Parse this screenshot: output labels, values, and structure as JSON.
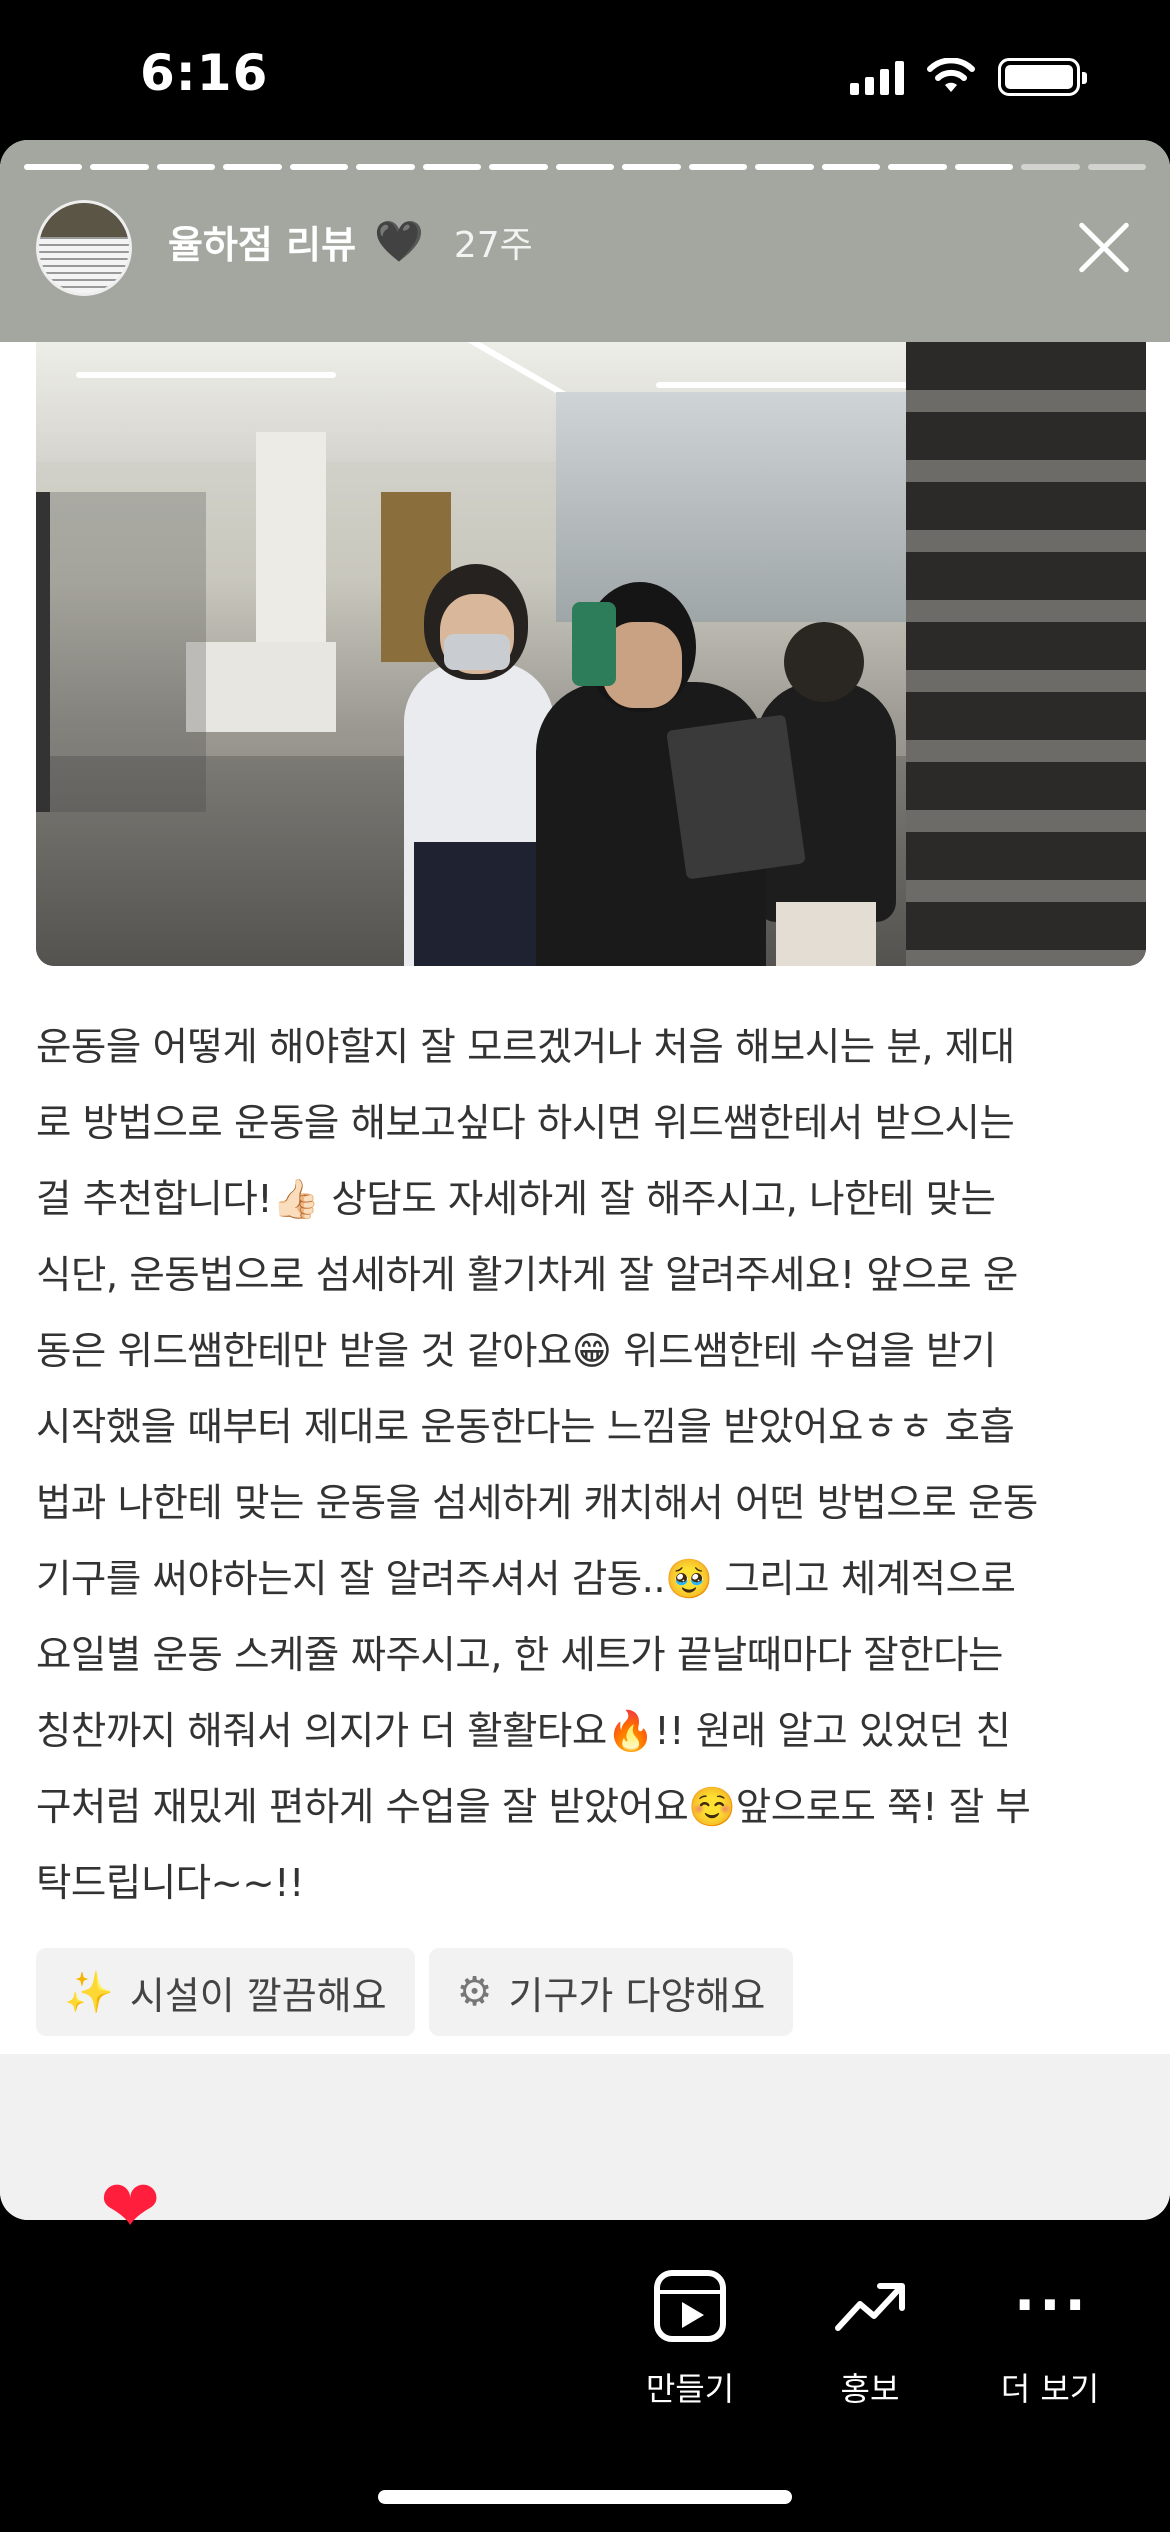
{
  "status_bar": {
    "time": "6:16"
  },
  "story": {
    "progress": {
      "total": 17,
      "current": 15
    },
    "user_name": "율하점 리뷰",
    "user_heart": "🖤",
    "time_ago": "27주",
    "review_text": "운동을 어떻게 해야할지 잘 모르겠거나 처음 해보시는 분, 제대\n로 방법으로 운동을 해보고싶다 하시면 위드쌤한테서 받으시는\n걸 추천합니다!👍🏻 상담도 자세하게 잘 해주시고, 나한테 맞는\n식단, 운동법으로 섬세하게 활기차게 잘 알려주세요! 앞으로 운\n동은 위드쌤한테만 받을 것 같아요😁 위드쌤한테 수업을 받기\n시작했을 때부터 제대로 운동한다는 느낌을 받았어요ㅎㅎ 호흡\n법과 나한테 맞는 운동을 섬세하게 캐치해서 어떤 방법으로 운동\n기구를 써야하는지 잘 알려주셔서 감동..🥹 그리고 체계적으로\n요일별 운동 스케쥴 짜주시고, 한 세트가 끝날때마다 잘한다는\n칭찬까지 해줘서 의지가 더 활활타요🔥!! 원래 알고 있었던 친\n구처럼 재밌게 편하게 수업을 잘 받았어요☺️앞으로도 쭉! 잘 부\n탁드립니다~~!!",
    "tags": [
      {
        "icon": "✨",
        "label": "시설이 깔끔해요"
      },
      {
        "icon": "⚙",
        "label": "기구가 다양해요"
      }
    ]
  },
  "like_icon": "❤",
  "actions": {
    "create_label": "만들기",
    "promote_label": "홍보",
    "more_label": "더 보기",
    "more_icon": "···"
  }
}
